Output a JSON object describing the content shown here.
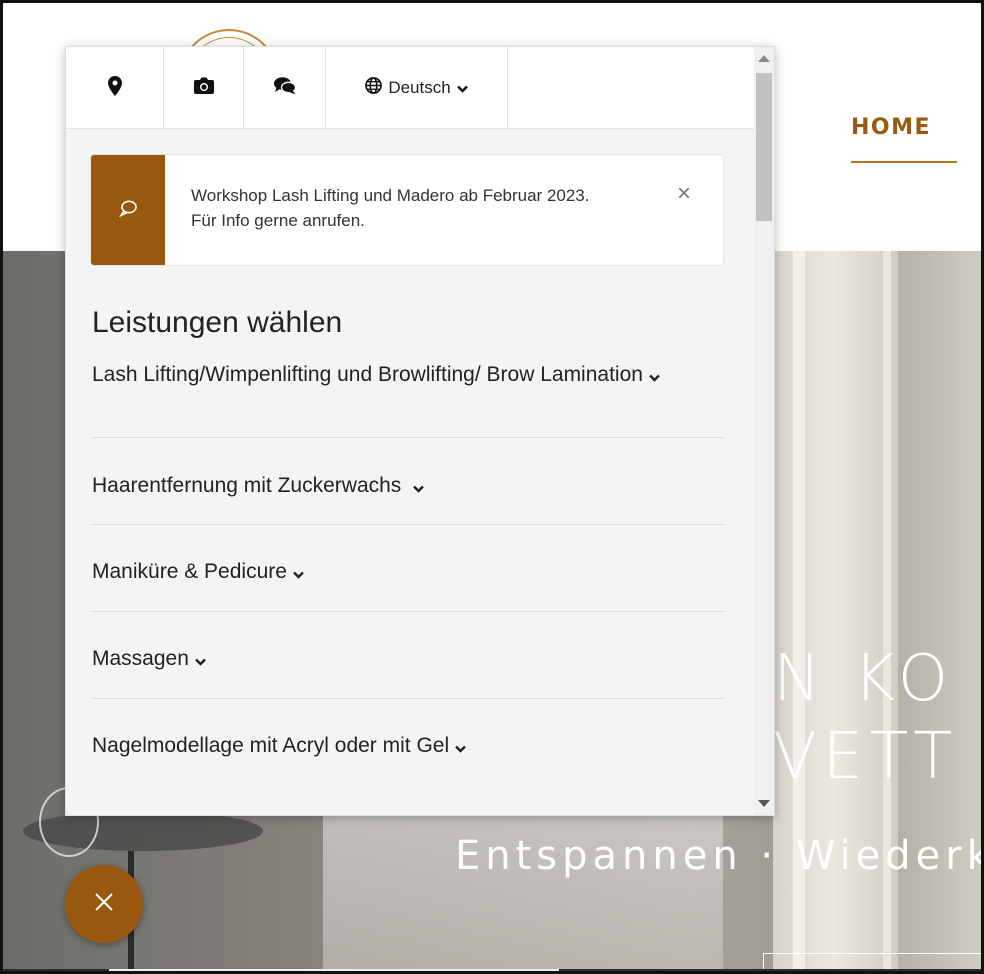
{
  "site": {
    "nav_home": "HOME",
    "hero_title_line1": "N KO",
    "hero_title_line2": "VETT",
    "hero_subtitle": "Entspannen · Wiederk"
  },
  "toolbar": {
    "location_icon": "map-marker-icon",
    "camera_icon": "camera-icon",
    "chat_icon": "comments-icon",
    "globe_icon": "globe-icon",
    "language_label": "Deutsch"
  },
  "notice": {
    "icon": "speech-bubble-icon",
    "text": "Workshop Lash Lifting und Madero ab Februar 2023. Für Info gerne anrufen.",
    "close_label": "×"
  },
  "services": {
    "title": "Leistungen wählen",
    "items": [
      {
        "label": "Lash Lifting/Wimpenlifting und Browlifting/ Brow Lamination"
      },
      {
        "label": "Haarentfernung mit Zuckerwachs "
      },
      {
        "label": "Maniküre & Pedicure"
      },
      {
        "label": "Massagen"
      },
      {
        "label": "Nagelmodellage mit Acryl oder mit Gel"
      }
    ]
  },
  "fab": {
    "icon": "close-icon"
  },
  "colors": {
    "accent": "#98590f",
    "nav_text": "#9b5a12"
  }
}
